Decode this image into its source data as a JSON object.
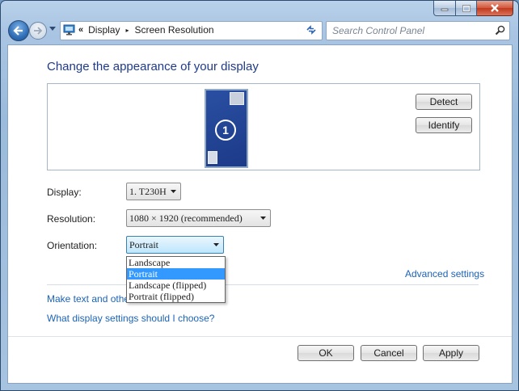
{
  "window": {
    "caption_buttons": [
      "minimize-icon",
      "maximize-icon",
      "close-icon"
    ]
  },
  "navigation": {
    "breadcrumb_prefix": "«",
    "breadcrumb": [
      "Display",
      "Screen Resolution"
    ],
    "breadcrumb_separator": "▸",
    "search_placeholder": "Search Control Panel"
  },
  "main": {
    "heading": "Change the appearance of your display",
    "preview": {
      "monitor_number": "1",
      "detect_label": "Detect",
      "identify_label": "Identify"
    },
    "fields": {
      "display": {
        "label": "Display:",
        "value": "1. T230H"
      },
      "resolution": {
        "label": "Resolution:",
        "value": "1080 × 1920 (recommended)"
      },
      "orientation": {
        "label": "Orientation:",
        "value": "Portrait",
        "options": [
          "Landscape",
          "Portrait",
          "Landscape (flipped)",
          "Portrait (flipped)"
        ],
        "selected_index": 1
      }
    },
    "advanced_settings": "Advanced settings",
    "link_text_size_visible": "Make text and other",
    "link_help": "What display settings should I choose?"
  },
  "footer": {
    "ok": "OK",
    "cancel": "Cancel",
    "apply": "Apply"
  },
  "colors": {
    "link": "#1b63b8",
    "heading": "#1e3a8a",
    "selection": "#3399ff",
    "monitor_fill": "#2a4fa2"
  }
}
